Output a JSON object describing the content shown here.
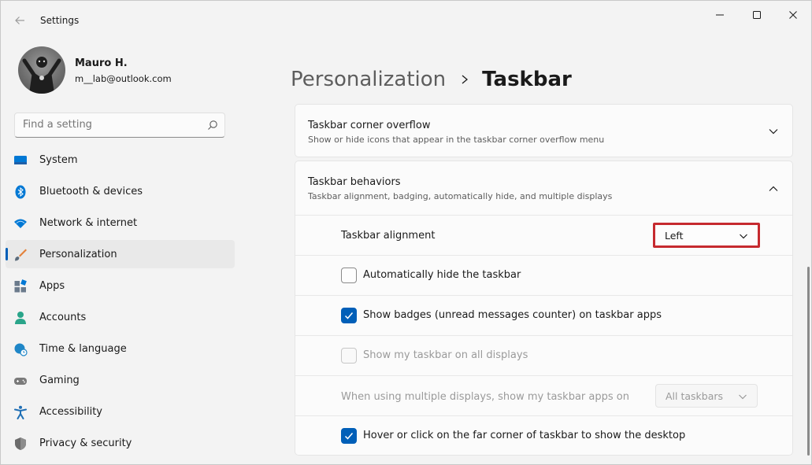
{
  "window": {
    "title": "Settings"
  },
  "profile": {
    "name": "Mauro H.",
    "email": "m__lab@outlook.com"
  },
  "search": {
    "placeholder": "Find a setting"
  },
  "sidebar": {
    "items": [
      {
        "label": "System",
        "icon": "system-icon",
        "color": "#0078d4"
      },
      {
        "label": "Bluetooth & devices",
        "icon": "bluetooth-icon",
        "color": "#0078d4"
      },
      {
        "label": "Network & internet",
        "icon": "wifi-icon",
        "color": "#0078d4"
      },
      {
        "label": "Personalization",
        "icon": "brush-icon",
        "color": "#e3813a",
        "active": true
      },
      {
        "label": "Apps",
        "icon": "apps-icon",
        "color": "#5a6b7b"
      },
      {
        "label": "Accounts",
        "icon": "person-icon",
        "color": "#2aa58a"
      },
      {
        "label": "Time & language",
        "icon": "globe-clock-icon",
        "color": "#1f86c7"
      },
      {
        "label": "Gaming",
        "icon": "gamepad-icon",
        "color": "#7a7a7a"
      },
      {
        "label": "Accessibility",
        "icon": "accessibility-icon",
        "color": "#1f6fb5"
      },
      {
        "label": "Privacy & security",
        "icon": "shield-icon",
        "color": "#6b6b6b"
      }
    ]
  },
  "breadcrumb": {
    "parent": "Personalization",
    "current": "Taskbar"
  },
  "sections": {
    "overflow": {
      "title": "Taskbar corner overflow",
      "description": "Show or hide icons that appear in the taskbar corner overflow menu",
      "expanded": false
    },
    "behaviors": {
      "title": "Taskbar behaviors",
      "description": "Taskbar alignment, badging, automatically hide, and multiple displays",
      "expanded": true,
      "alignment_label": "Taskbar alignment",
      "alignment_value": "Left",
      "auto_hide_label": "Automatically hide the taskbar",
      "auto_hide_checked": false,
      "badges_label": "Show badges (unread messages counter) on taskbar apps",
      "badges_checked": true,
      "all_displays_label": "Show my taskbar on all displays",
      "all_displays_checked": false,
      "multi_display_label": "When using multiple displays, show my taskbar apps on",
      "multi_display_value": "All taskbars",
      "far_corner_label": "Hover or click on the far corner of taskbar to show the desktop",
      "far_corner_checked": true
    }
  },
  "colors": {
    "accent": "#005fb8",
    "highlight_border": "#c62a2f"
  }
}
